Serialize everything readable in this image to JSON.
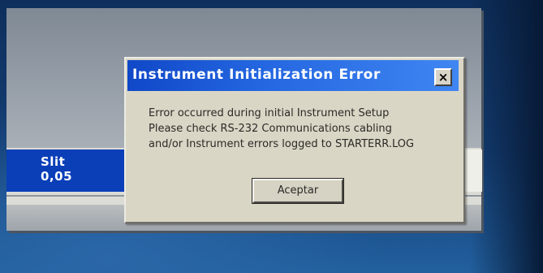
{
  "app": {
    "slit_label": "Slit",
    "slit_value": "0,05"
  },
  "dialog": {
    "title": "Instrument Initialization Error",
    "close_glyph": "×",
    "message_lines": [
      "Error occurred during initial Instrument Setup",
      "Please check RS-232 Communications cabling",
      "and/or Instrument errors logged to STARTERR.LOG"
    ],
    "ok_label": "Aceptar"
  }
}
